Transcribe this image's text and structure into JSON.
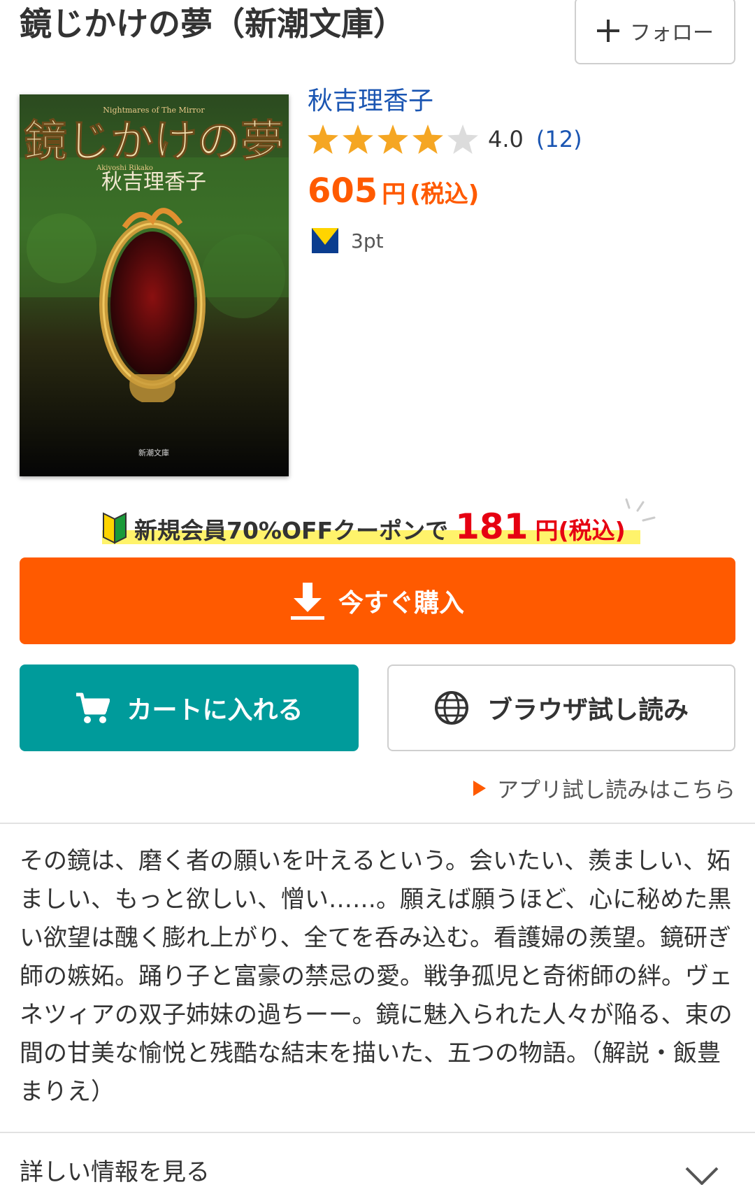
{
  "book": {
    "title": "鏡じかけの夢（新潮文庫）",
    "author": "秋吉理香子",
    "rating_value": "4.0",
    "rating_count": "(12)",
    "rating_stars": 4,
    "price_number": "605",
    "price_unit": "円",
    "price_tax": "(税込)",
    "points": "3pt",
    "cover": {
      "title_text": "鏡じかけの夢",
      "subtitle_en": "Nightmares of The Mirror",
      "author_en": "Akiyoshi Rikako",
      "author_jp": "秋吉理香子",
      "publisher_label": "新潮文庫"
    }
  },
  "follow": {
    "label": "フォロー"
  },
  "coupon": {
    "text": "新規会員70%OFFクーポンで",
    "amount": "181",
    "yen_tax": "円(税込)"
  },
  "actions": {
    "buy_now": "今すぐ購入",
    "add_to_cart": "カートに入れる",
    "browser_preview": "ブラウザ試し読み",
    "app_preview": "アプリ試し読みはこちら"
  },
  "description": "その鏡は、磨く者の願いを叶えるという。会いたい、羨ましい、妬ましい、もっと欲しい、憎い……。願えば願うほど、心に秘めた黒い欲望は醜く膨れ上がり、全てを呑み込む。看護婦の羨望。鏡研ぎ師の嫉妬。踊り子と富豪の禁忌の愛。戦争孤児と奇術師の絆。ヴェネツィアの双子姉妹の過ちーー。鏡に魅入られた人々が陥る、束の間の甘美な愉悦と残酷な結末を描いた、五つの物語。（解説・飯豊まりえ）",
  "details": {
    "label": "詳しい情報を見る"
  },
  "colors": {
    "accent_orange": "#ff5a00",
    "cart_teal": "#009b9b",
    "link_blue": "#1a55b2",
    "coupon_red": "#e60012",
    "star_gold": "#f5a623"
  },
  "icons": {
    "follow": "plus-icon",
    "buy": "download-icon",
    "cart": "cart-icon",
    "browse": "globe-icon",
    "app": "triangle-right-icon",
    "details": "chevron-down-icon",
    "coupon": "beginner-mark-icon",
    "points": "t-point-icon"
  }
}
